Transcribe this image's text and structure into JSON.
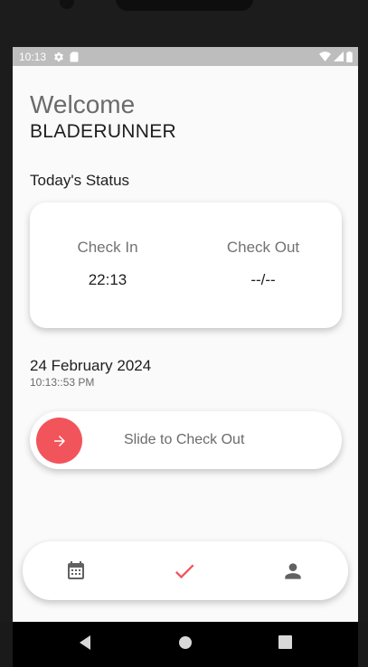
{
  "status_bar": {
    "time": "10:13",
    "icons": [
      "gear-icon",
      "sd-card-icon",
      "wifi-icon",
      "signal-icon",
      "battery-icon"
    ]
  },
  "header": {
    "greeting": "Welcome",
    "username": "BLADERUNNER"
  },
  "status": {
    "heading": "Today's Status",
    "check_in_label": "Check In",
    "check_in_value": "22:13",
    "check_out_label": "Check Out",
    "check_out_value": "--/--"
  },
  "datetime": {
    "date": "24 February 2024",
    "time": "10:13::53 PM"
  },
  "slider": {
    "label": "Slide to Check Out",
    "icon": "arrow-right-icon",
    "accent": "#f2545b"
  },
  "bottom_nav": {
    "items": [
      {
        "icon": "calendar-icon",
        "active": false
      },
      {
        "icon": "check-icon",
        "active": true
      },
      {
        "icon": "person-icon",
        "active": false
      }
    ],
    "active_color": "#f2545b",
    "inactive_color": "#616161"
  },
  "system_nav": [
    "back-icon",
    "home-icon",
    "recents-icon"
  ]
}
